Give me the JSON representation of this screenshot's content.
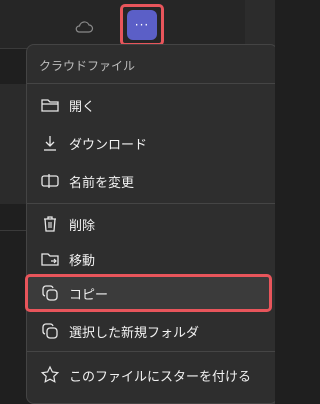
{
  "toolbar": {
    "cloud_icon": "cloud-icon",
    "more_button_label": "···",
    "accent": "#5b5fc7",
    "highlight_color": "#e8555b"
  },
  "menu": {
    "header": "クラウドファイル",
    "items": [
      {
        "label": "開く",
        "icon": "folder-open-icon"
      },
      {
        "label": "ダウンロード",
        "icon": "download-icon"
      },
      {
        "label": "名前を変更",
        "icon": "rename-icon"
      },
      {
        "label": "削除",
        "icon": "trash-icon"
      },
      {
        "label": "移動",
        "icon": "move-folder-icon"
      },
      {
        "label": "コピー",
        "icon": "copy-icon"
      },
      {
        "label": "選択した新規フォルダ",
        "icon": "copy-to-folder-icon"
      },
      {
        "label": "このファイルにスターを付ける",
        "icon": "star-icon"
      }
    ],
    "highlighted_item": "コピー"
  }
}
